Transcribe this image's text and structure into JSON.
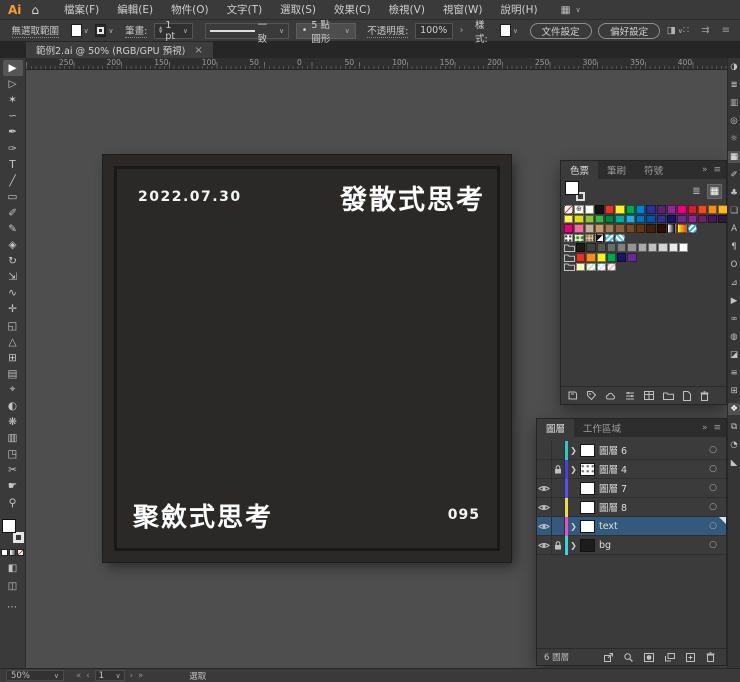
{
  "colors": {
    "accent_selection": "#33597d",
    "canvas": "#4e4e4e",
    "artboard": "#2a2928",
    "chrome": "#3a3a3a"
  },
  "icons": {
    "caret_down": "∨",
    "chevron_right": "›",
    "double_chevron": "»",
    "panel_menu": "≡",
    "close": "×",
    "home": "⌂",
    "workspace": "▦",
    "bullet": "•",
    "greater": "❯",
    "list_view": "≣",
    "grid_view": "▦",
    "target_circle": "○",
    "nav_first": "«",
    "nav_prev": "‹",
    "nav_next": "›",
    "nav_last": "»",
    "dots_more": "⋯",
    "ctrl_icon_1": "∷",
    "ctrl_icon_2": "⇉",
    "draw_mode": "◧",
    "screen_mode": "◫",
    "select_similar": "◨"
  },
  "app": {
    "logo": "Ai",
    "menus": [
      "檔案(F)",
      "編輯(E)",
      "物件(O)",
      "文字(T)",
      "選取(S)",
      "效果(C)",
      "檢視(V)",
      "視窗(W)",
      "說明(H)"
    ]
  },
  "control_bar": {
    "selection_status": "無選取範圍",
    "stroke_label": "筆畫:",
    "stroke_value": "1 pt",
    "stroke_profile": "一致",
    "brush_value": "5 點圓形",
    "opacity_label": "不透明度:",
    "opacity_value": "100%",
    "style_label": "樣式:",
    "doc_setup_button": "文件設定",
    "preferences_button": "偏好設定"
  },
  "document_tab": {
    "title": "範例2.ai @ 50% (RGB/GPU 預視)"
  },
  "ruler": {
    "labels": [
      "250",
      "200",
      "150",
      "100",
      "50",
      "0",
      "50",
      "100",
      "150",
      "200",
      "250",
      "300",
      "350",
      "400"
    ]
  },
  "toolbar": {
    "tools": [
      {
        "name": "selection-tool",
        "glyph": "▶",
        "active": true
      },
      {
        "name": "direct-selection-tool",
        "glyph": "▷"
      },
      {
        "name": "magic-wand-tool",
        "glyph": "✶"
      },
      {
        "name": "lasso-tool",
        "glyph": "∽"
      },
      {
        "name": "pen-tool",
        "glyph": "✒"
      },
      {
        "name": "curvature-tool",
        "glyph": "✑"
      },
      {
        "name": "type-tool",
        "glyph": "T"
      },
      {
        "name": "line-segment-tool",
        "glyph": "╱"
      },
      {
        "name": "rectangle-tool",
        "glyph": "▭"
      },
      {
        "name": "paintbrush-tool",
        "glyph": "✐"
      },
      {
        "name": "pencil-tool",
        "glyph": "✎"
      },
      {
        "name": "eraser-tool",
        "glyph": "◈"
      },
      {
        "name": "rotate-tool",
        "glyph": "↻"
      },
      {
        "name": "scale-tool",
        "glyph": "⇲"
      },
      {
        "name": "width-tool",
        "glyph": "∿"
      },
      {
        "name": "puppet-warp-tool",
        "glyph": "✛"
      },
      {
        "name": "shape-builder-tool",
        "glyph": "◱"
      },
      {
        "name": "perspective-grid-tool",
        "glyph": "△"
      },
      {
        "name": "mesh-tool",
        "glyph": "⊞"
      },
      {
        "name": "gradient-tool",
        "glyph": "▤"
      },
      {
        "name": "eyedropper-tool",
        "glyph": "⌖"
      },
      {
        "name": "blend-tool",
        "glyph": "◐"
      },
      {
        "name": "symbol-sprayer-tool",
        "glyph": "❋"
      },
      {
        "name": "column-graph-tool",
        "glyph": "▥"
      },
      {
        "name": "artboard-tool",
        "glyph": "◳"
      },
      {
        "name": "slice-tool",
        "glyph": "✂"
      },
      {
        "name": "hand-tool",
        "glyph": "☛"
      },
      {
        "name": "zoom-tool",
        "glyph": "⚲"
      }
    ]
  },
  "canvas": {
    "artboard": {
      "date": "2022.07.30",
      "title_top_right": "發散式思考",
      "title_bottom_left": "聚斂式思考",
      "page_number": "095"
    }
  },
  "swatches_panel": {
    "tabs": [
      {
        "label": "色票",
        "active": true
      },
      {
        "label": "筆刷",
        "active": false
      },
      {
        "label": "符號",
        "active": false
      }
    ],
    "rows": [
      [
        "none",
        "registration",
        "#ffffff",
        "#141414",
        "#e5332a",
        "#fdee2e",
        "#00a650",
        "#0083ca",
        "#2e3192",
        "#56256e",
        "#8f2a90",
        "#e5007e",
        "#cf2030",
        "#e94e1b",
        "#f18f1f",
        "#fbbb21"
      ],
      [
        "#fff45c",
        "#d7df23",
        "#8cc63e",
        "#39b54a",
        "#00843d",
        "#00a99e",
        "#29abe2",
        "#0071bc",
        "#0054a5",
        "#2e3192",
        "#1b1464",
        "#662c90",
        "#93268f",
        "#6e2262",
        "#45195e",
        "#2b1b40"
      ],
      [
        "#e5007e",
        "#ef6ea8",
        "#c7b299",
        "#c69c6d",
        "#a67c52",
        "#8c6239",
        "#754c24",
        "#603913",
        "#42210b",
        "#2b1105",
        "grad:#ffffff,#000000",
        "grad:#fff200,#e54e26",
        "pattern:check-blue"
      ],
      [
        "pattern:dots",
        "pattern:leaves",
        "pattern:texture",
        "pattern:diag-bw",
        "pattern:diag-cyan",
        "pattern:diag-cyan2"
      ],
      [
        "folder",
        "#1a1a1a",
        "#404040",
        "#565656",
        "#6b6b6b",
        "#808080",
        "#959595",
        "#ababab",
        "#c0c0c0",
        "#d5d5d5",
        "#eaeaea",
        "#ffffff"
      ],
      [
        "folder",
        "#e5332a",
        "#f18f1f",
        "#fdee2e",
        "#00a650",
        "#1b1464",
        "#662c90"
      ],
      [
        "folder",
        "#fdfdc4",
        "pattern:diag-green",
        "pattern:diag-aqua",
        "pattern:diag-pink"
      ]
    ],
    "bottom_icons": [
      "swatch-libraries-menu",
      "swatch-kinds-menu",
      "cc-libraries",
      "swatch-options",
      "color-themes",
      "new-color-group",
      "new-swatch",
      "delete-swatch"
    ]
  },
  "layers_panel": {
    "tabs": [
      {
        "label": "圖層",
        "active": true
      },
      {
        "label": "工作區域",
        "active": false
      }
    ],
    "layers": [
      {
        "name": "圖層 6",
        "eye": false,
        "lock": false,
        "color": "#2ec9b8",
        "expand": true,
        "thumb": "white",
        "selected": false
      },
      {
        "name": "圖層 4",
        "eye": false,
        "lock": true,
        "color": "#4b3fe4",
        "expand": true,
        "thumb": "dots",
        "selected": false
      },
      {
        "name": "圖層 7",
        "eye": true,
        "lock": false,
        "color": "#5a4fee",
        "expand": false,
        "thumb": "white",
        "selected": false
      },
      {
        "name": "圖層 8",
        "eye": true,
        "lock": false,
        "color": "#e8e23a",
        "expand": false,
        "thumb": "white",
        "selected": false
      },
      {
        "name": "text",
        "eye": true,
        "lock": false,
        "color": "#e14fd2",
        "expand": true,
        "thumb": "white",
        "selected": true
      },
      {
        "name": "bg",
        "eye": true,
        "lock": true,
        "color": "#38d6d6",
        "expand": true,
        "thumb": "dark",
        "selected": false
      }
    ],
    "count_label": "6 圖層",
    "bottom_icons": [
      "collect-for-export",
      "locate-object",
      "make-clipping-mask",
      "new-sublayer",
      "new-layer",
      "delete-layer"
    ]
  },
  "dock": {
    "icons": [
      {
        "name": "color-panel",
        "glyph": "◑"
      },
      {
        "name": "properties-panel",
        "glyph": "≣"
      },
      {
        "name": "gradient-panel",
        "glyph": "▥"
      },
      {
        "name": "transparency-panel",
        "glyph": "◎"
      },
      {
        "name": "appearance-panel",
        "glyph": "☼"
      },
      {
        "name": "swatches-panel",
        "glyph": "▦",
        "active": true
      },
      {
        "name": "brushes-panel",
        "glyph": "✐"
      },
      {
        "name": "symbols-panel",
        "glyph": "♣"
      },
      {
        "name": "graphic-styles-panel",
        "glyph": "❏"
      },
      {
        "name": "character-panel",
        "glyph": "A"
      },
      {
        "name": "paragraph-panel",
        "glyph": "¶"
      },
      {
        "name": "opentype-panel",
        "glyph": "O"
      },
      {
        "name": "glyphs-panel",
        "glyph": "⊿"
      },
      {
        "name": "actions-panel",
        "glyph": "▶"
      },
      {
        "name": "links-panel",
        "glyph": "∞"
      },
      {
        "name": "pathfinder-panel",
        "glyph": "◍"
      },
      {
        "name": "image-trace-panel",
        "glyph": "◪"
      },
      {
        "name": "align-panel",
        "glyph": "≡"
      },
      {
        "name": "transform-panel",
        "glyph": "⊞"
      },
      {
        "name": "layers-panel",
        "glyph": "❖",
        "active": true
      },
      {
        "name": "artboards-panel",
        "glyph": "⧉"
      },
      {
        "name": "asset-export-panel",
        "glyph": "◔"
      },
      {
        "name": "navigator-panel",
        "glyph": "◣"
      }
    ]
  },
  "status_bar": {
    "zoom": "50%",
    "artboard_nav_value": "1",
    "tool_status": "選取"
  }
}
